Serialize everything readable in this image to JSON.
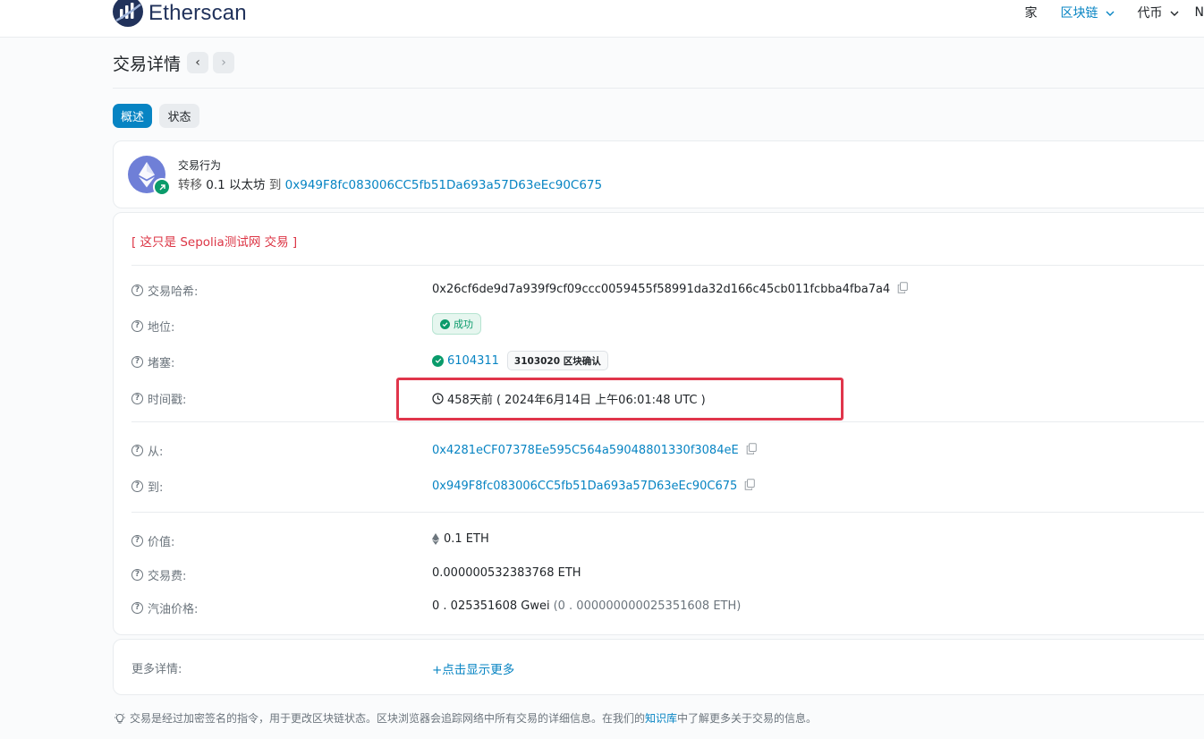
{
  "header": {
    "logo_text": "Etherscan",
    "nav": [
      {
        "label": "家"
      },
      {
        "label": "区块链"
      },
      {
        "label": "代币"
      },
      {
        "label": "N"
      }
    ]
  },
  "page": {
    "title": "交易详情",
    "prev_arrow": "‹",
    "next_arrow": "›",
    "tabs": [
      {
        "label": "概述"
      },
      {
        "label": "状态"
      }
    ]
  },
  "action": {
    "label": "交易行为",
    "verb": "转移",
    "amount": "0.1 以太坊",
    "to_word": "到",
    "to_address": "0x949F8fc083006CC5fb51Da693a57D63eEc90C675"
  },
  "testnet_note": "[ 这只是 Sepolia测试网 交易 ]",
  "details": {
    "hash": {
      "label": "交易哈希:",
      "value": "0x26cf6de9d7a939f9cf09ccc0059455f58991da32d166c45cb011fcbba4fba7a4"
    },
    "status": {
      "label": "地位:",
      "value": "成功"
    },
    "block": {
      "label": "堵塞:",
      "value": "6104311",
      "confirmations": "3103020 区块确认"
    },
    "timestamp": {
      "label": "时间戳:",
      "value": "458天前 ( 2024年6月14日 上午06:01:48 UTC )"
    },
    "from": {
      "label": "从:",
      "value": "0x4281eCF07378Ee595C564a59048801330f3084eE"
    },
    "to": {
      "label": "到:",
      "value": "0x949F8fc083006CC5fb51Da693a57D63eEc90C675"
    },
    "value": {
      "label": "价值:",
      "value": "0.1 ETH"
    },
    "fee": {
      "label": "交易费:",
      "value": "0.000000532383768 ETH"
    },
    "gas_price": {
      "label": "汽油价格:",
      "value": "0 . 025351608 Gwei",
      "eth": "(0 . 000000000025351608 ETH)"
    }
  },
  "more": {
    "label": "更多详情:",
    "link": "+点击显示更多"
  },
  "footer": {
    "text_before": "交易是经过加密签名的指令，用于更改区块链状态。区块浏览器会追踪网络中所有交易的详细信息。在我们的",
    "link": "知识库",
    "text_after": "中了解更多关于交易的信息。"
  },
  "colors": {
    "accent": "#0784c3",
    "success": "#0a9b6b",
    "danger": "#dc3545",
    "highlight": "#e0354b"
  }
}
